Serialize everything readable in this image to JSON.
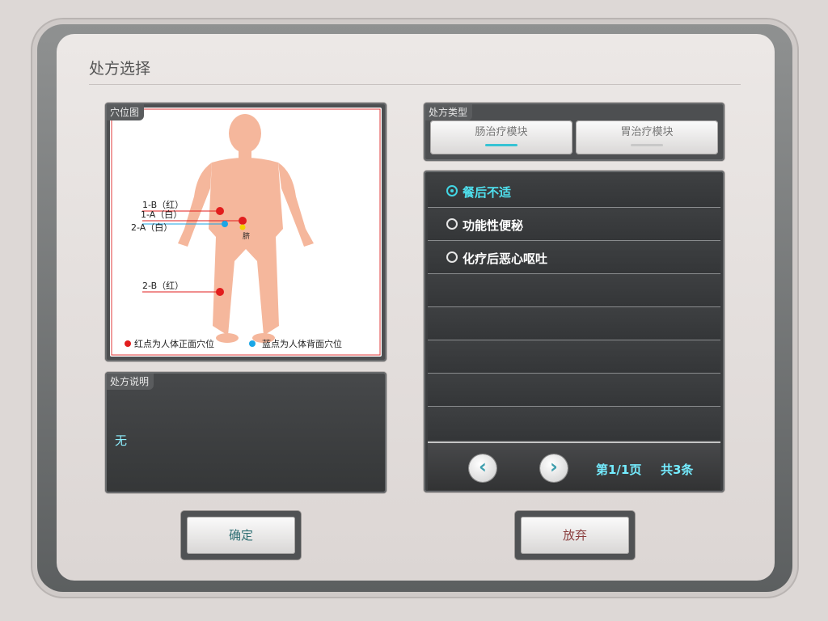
{
  "dialog": {
    "title": "处方选择"
  },
  "acupoint_panel": {
    "tag": "穴位图",
    "labels": {
      "p1": "1-B（红）",
      "p2": "1-A（白）",
      "p3": "2-A（白）",
      "navel": "脐",
      "p4": "2-B（红）"
    },
    "legend": {
      "red": "红点为人体正面穴位",
      "blue": "蓝点为人体背面穴位"
    },
    "colors": {
      "body": "#f5b79c",
      "red_point": "#e21d1d",
      "blue_point": "#1aa6e6",
      "yellow_point": "#f2d200"
    }
  },
  "description_panel": {
    "tag": "处方说明",
    "text": "无"
  },
  "type_panel": {
    "tag": "处方类型",
    "buttons": [
      {
        "label": "肠治疗模块",
        "active": true,
        "bar_color": "#36c3d4"
      },
      {
        "label": "胃治疗模块",
        "active": false,
        "bar_color": "#c8c8c8"
      }
    ]
  },
  "prescription_list": {
    "items": [
      {
        "label": "餐后不适",
        "selected": true
      },
      {
        "label": "功能性便秘",
        "selected": false
      },
      {
        "label": "化疗后恶心呕吐",
        "selected": false
      }
    ],
    "pager": {
      "page_text": "第1/1页",
      "count_text": "共3条",
      "prev_icon": "‹",
      "next_icon": "›"
    }
  },
  "actions": {
    "confirm": "确定",
    "cancel": "放弃"
  },
  "colors": {
    "accent": "#4fe0ee"
  }
}
